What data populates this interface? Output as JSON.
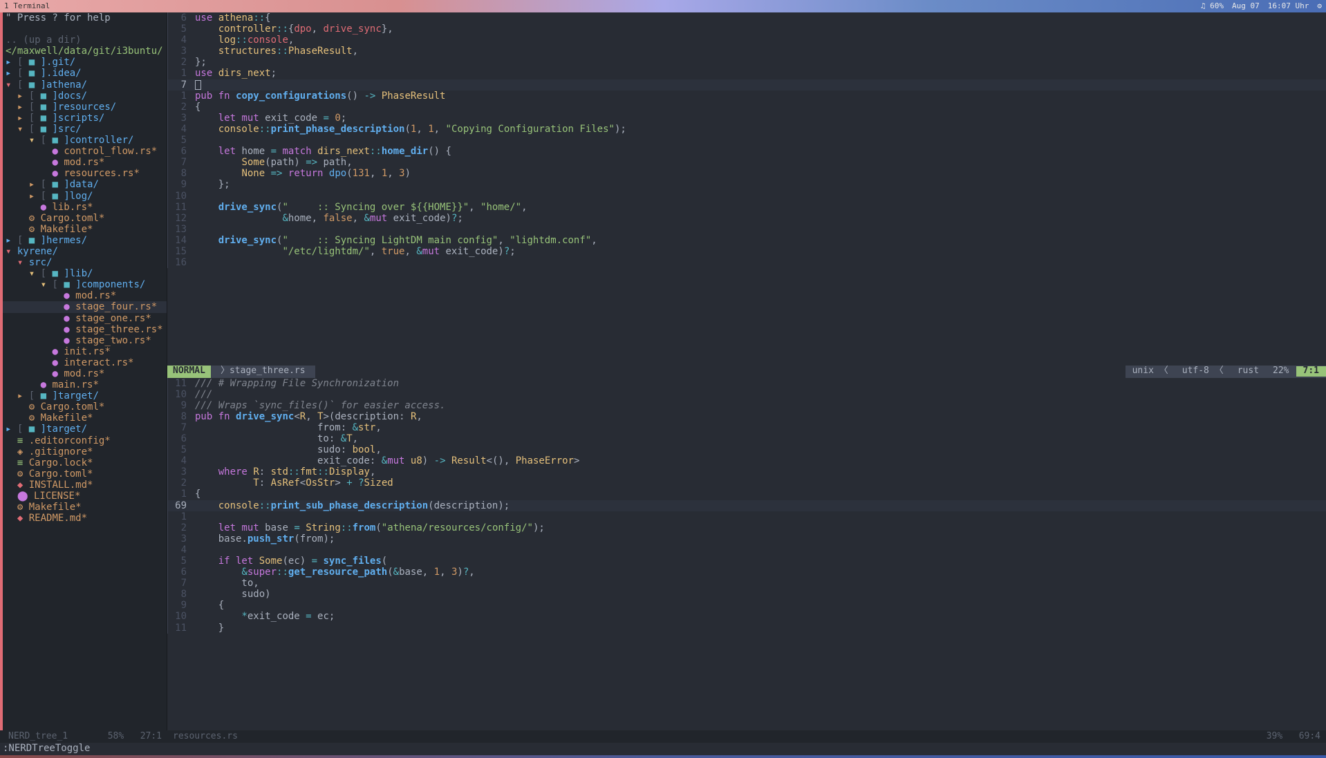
{
  "titlebar": {
    "left": "1 Terminal",
    "battery": "♫ 60%",
    "date": "Aug 07",
    "time": "16:07 Uhr"
  },
  "sidebar": {
    "help": "\" Press ? for help",
    "updir": ".. (up a dir)",
    "path": "</maxwell/data/git/i3buntu/",
    "tree": [
      {
        "indent": 0,
        "arrow": "▸",
        "arrowc": "arrow-b",
        "icon": "■",
        "name": "].git/",
        "dir": true
      },
      {
        "indent": 0,
        "arrow": "▸",
        "arrowc": "arrow-b",
        "icon": "■",
        "name": "].idea/",
        "dir": true
      },
      {
        "indent": 0,
        "arrow": "▾",
        "arrowc": "arrow",
        "icon": "■",
        "name": "]athena/",
        "dir": true
      },
      {
        "indent": 1,
        "arrow": "▸",
        "arrowc": "arrow-o",
        "icon": "■",
        "name": "]docs/",
        "dir": true
      },
      {
        "indent": 1,
        "arrow": "▸",
        "arrowc": "arrow-o",
        "icon": "■",
        "name": "]resources/",
        "dir": true
      },
      {
        "indent": 1,
        "arrow": "▸",
        "arrowc": "arrow-o",
        "icon": "■",
        "name": "]scripts/",
        "dir": true
      },
      {
        "indent": 1,
        "arrow": "▾",
        "arrowc": "arrow-o",
        "icon": "■",
        "name": "]src/",
        "dir": true
      },
      {
        "indent": 2,
        "arrow": "▾",
        "arrowc": "arrow-gold",
        "icon": "■",
        "name": "]controller/",
        "dir": true
      },
      {
        "indent": 3,
        "arrow": "",
        "arrowc": "",
        "icon": "●",
        "iconc": "file-ico",
        "name": "control_flow.rs*",
        "dir": false
      },
      {
        "indent": 3,
        "arrow": "",
        "arrowc": "",
        "icon": "●",
        "iconc": "file-ico",
        "name": "mod.rs*",
        "dir": false
      },
      {
        "indent": 3,
        "arrow": "",
        "arrowc": "",
        "icon": "●",
        "iconc": "file-ico",
        "name": "resources.rs*",
        "dir": false
      },
      {
        "indent": 2,
        "arrow": "▸",
        "arrowc": "arrow-o",
        "icon": "■",
        "name": "]data/",
        "dir": true
      },
      {
        "indent": 2,
        "arrow": "▸",
        "arrowc": "arrow-o",
        "icon": "■",
        "name": "]log/",
        "dir": true
      },
      {
        "indent": 2,
        "arrow": "",
        "arrowc": "",
        "icon": "●",
        "iconc": "file-ico",
        "name": "lib.rs*",
        "dir": false
      },
      {
        "indent": 1,
        "arrow": "",
        "arrowc": "",
        "icon": "⚙",
        "iconc": "file-ico-o",
        "name": "Cargo.toml*",
        "dir": false
      },
      {
        "indent": 1,
        "arrow": "",
        "arrowc": "",
        "icon": "⚙",
        "iconc": "file-ico-o",
        "name": "Makefile*",
        "dir": false
      },
      {
        "indent": 0,
        "arrow": "▸",
        "arrowc": "arrow-b",
        "icon": "■",
        "name": "]hermes/",
        "dir": true
      },
      {
        "indent": 0,
        "arrow": "▾",
        "arrowc": "arrow",
        "icon": "",
        "name": "kyrene/",
        "dir": true,
        "nobracket": true
      },
      {
        "indent": 1,
        "arrow": "▾",
        "arrowc": "arrow",
        "icon": "",
        "name": "src/",
        "dir": true,
        "nobracket": true
      },
      {
        "indent": 2,
        "arrow": "▾",
        "arrowc": "arrow-gold",
        "icon": "■",
        "name": "]lib/",
        "dir": true
      },
      {
        "indent": 3,
        "arrow": "▾",
        "arrowc": "arrow-gold",
        "icon": "■",
        "name": "]components/",
        "dir": true
      },
      {
        "indent": 4,
        "arrow": "",
        "arrowc": "",
        "icon": "●",
        "iconc": "file-ico",
        "name": "mod.rs*",
        "dir": false
      },
      {
        "indent": 4,
        "arrow": "",
        "arrowc": "",
        "icon": "●",
        "iconc": "file-ico",
        "name": "stage_four.rs*",
        "dir": false,
        "hl": true
      },
      {
        "indent": 4,
        "arrow": "",
        "arrowc": "",
        "icon": "●",
        "iconc": "file-ico",
        "name": "stage_one.rs*",
        "dir": false
      },
      {
        "indent": 4,
        "arrow": "",
        "arrowc": "",
        "icon": "●",
        "iconc": "file-ico",
        "name": "stage_three.rs*",
        "dir": false
      },
      {
        "indent": 4,
        "arrow": "",
        "arrowc": "",
        "icon": "●",
        "iconc": "file-ico",
        "name": "stage_two.rs*",
        "dir": false
      },
      {
        "indent": 3,
        "arrow": "",
        "arrowc": "",
        "icon": "●",
        "iconc": "file-ico",
        "name": "init.rs*",
        "dir": false
      },
      {
        "indent": 3,
        "arrow": "",
        "arrowc": "",
        "icon": "●",
        "iconc": "file-ico",
        "name": "interact.rs*",
        "dir": false
      },
      {
        "indent": 3,
        "arrow": "",
        "arrowc": "",
        "icon": "●",
        "iconc": "file-ico",
        "name": "mod.rs*",
        "dir": false
      },
      {
        "indent": 2,
        "arrow": "",
        "arrowc": "",
        "icon": "●",
        "iconc": "file-ico",
        "name": "main.rs*",
        "dir": false
      },
      {
        "indent": 1,
        "arrow": "▸",
        "arrowc": "arrow-o",
        "icon": "■",
        "name": "]target/",
        "dir": true
      },
      {
        "indent": 1,
        "arrow": "",
        "arrowc": "",
        "icon": "⚙",
        "iconc": "file-ico-o",
        "name": "Cargo.toml*",
        "dir": false
      },
      {
        "indent": 1,
        "arrow": "",
        "arrowc": "",
        "icon": "⚙",
        "iconc": "file-ico-o",
        "name": "Makefile*",
        "dir": false
      },
      {
        "indent": 0,
        "arrow": "▸",
        "arrowc": "arrow-b",
        "icon": "■",
        "name": "]target/",
        "dir": true
      },
      {
        "indent": 0,
        "arrow": "",
        "arrowc": "",
        "icon": "≡",
        "iconc": "file-ico-g",
        "name": ".editorconfig*",
        "dir": false
      },
      {
        "indent": 0,
        "arrow": "",
        "arrowc": "",
        "icon": "◈",
        "iconc": "file-ico-o",
        "name": ".gitignore*",
        "dir": false
      },
      {
        "indent": 0,
        "arrow": "",
        "arrowc": "",
        "icon": "≡",
        "iconc": "file-ico-g",
        "name": "Cargo.lock*",
        "dir": false
      },
      {
        "indent": 0,
        "arrow": "",
        "arrowc": "",
        "icon": "⚙",
        "iconc": "file-ico-o",
        "name": "Cargo.toml*",
        "dir": false
      },
      {
        "indent": 0,
        "arrow": "",
        "arrowc": "",
        "icon": "◆",
        "iconc": "file-ico-r",
        "name": "INSTALL.md*",
        "dir": false
      },
      {
        "indent": 0,
        "arrow": "",
        "arrowc": "",
        "icon": "⬤",
        "iconc": "file-ico-p",
        "name": "LICENSE*",
        "dir": false
      },
      {
        "indent": 0,
        "arrow": "",
        "arrowc": "",
        "icon": "⚙",
        "iconc": "file-ico-o",
        "name": "Makefile*",
        "dir": false
      },
      {
        "indent": 0,
        "arrow": "",
        "arrowc": "",
        "icon": "◆",
        "iconc": "file-ico-r",
        "name": "README.md*",
        "dir": false
      }
    ]
  },
  "pane1": {
    "lines": [
      {
        "n": "6",
        "html": "<span class='kw'>use</span> <span class='ty'>athena</span><span class='op'>::</span><span class='punct'>{</span>"
      },
      {
        "n": "5",
        "html": "    <span class='ty'>controller</span><span class='op'>::</span><span class='punct'>{</span><span class='ident'>dpo</span><span class='punct'>,</span> <span class='ident'>drive_sync</span><span class='punct'>},</span>"
      },
      {
        "n": "4",
        "html": "    <span class='ty'>log</span><span class='op'>::</span><span class='ident'>console</span><span class='punct'>,</span>"
      },
      {
        "n": "3",
        "html": "    <span class='ty'>structures</span><span class='op'>::</span><span class='ty'>PhaseResult</span><span class='punct'>,</span>"
      },
      {
        "n": "2",
        "html": "<span class='punct'>};</span>"
      },
      {
        "n": "1",
        "html": "<span class='kw'>use</span> <span class='ty'>dirs_next</span><span class='punct'>;</span>"
      },
      {
        "n": "7",
        "html": "<span class='cursor-box'></span>",
        "hl": true
      },
      {
        "n": "1",
        "html": "<span class='kw'>pub fn</span> <span class='fn'>copy_configurations</span><span class='punct'>()</span> <span class='op'>-&gt;</span> <span class='ty'>PhaseResult</span>"
      },
      {
        "n": "2",
        "html": "<span class='punct'>{</span>"
      },
      {
        "n": "3",
        "html": "    <span class='kw'>let</span> <span class='kw'>mut</span> exit_code <span class='op'>=</span> <span class='num'>0</span><span class='punct'>;</span>"
      },
      {
        "n": "4",
        "html": "    <span class='ty'>console</span><span class='op'>::</span><span class='fn'>print_phase_description</span><span class='punct'>(</span><span class='num'>1</span><span class='punct'>,</span> <span class='num'>1</span><span class='punct'>,</span> <span class='str'>\"Copying Configuration Files\"</span><span class='punct'>);</span>"
      },
      {
        "n": "5",
        "html": ""
      },
      {
        "n": "6",
        "html": "    <span class='kw'>let</span> home <span class='op'>=</span> <span class='kw'>match</span> <span class='ty'>dirs_next</span><span class='op'>::</span><span class='fn'>home_dir</span><span class='punct'>()</span> <span class='punct'>{</span>"
      },
      {
        "n": "7",
        "html": "        <span class='ty'>Some</span><span class='punct'>(</span>path<span class='punct'>)</span> <span class='op'>=&gt;</span> path<span class='punct'>,</span>"
      },
      {
        "n": "8",
        "html": "        <span class='ty'>None</span> <span class='op'>=&gt;</span> <span class='kw'>return</span> <span class='fnc'>dpo</span><span class='punct'>(</span><span class='num'>131</span><span class='punct'>,</span> <span class='num'>1</span><span class='punct'>,</span> <span class='num'>3</span><span class='punct'>)</span>"
      },
      {
        "n": "9",
        "html": "    <span class='punct'>};</span>"
      },
      {
        "n": "10",
        "html": ""
      },
      {
        "n": "11",
        "html": "    <span class='fn'>drive_sync</span><span class='punct'>(</span><span class='str'>\"     :: Syncing over ${{HOME}}\"</span><span class='punct'>,</span> <span class='str'>\"home/\"</span><span class='punct'>,</span>"
      },
      {
        "n": "12",
        "html": "               <span class='op'>&amp;</span>home<span class='punct'>,</span> <span class='num'>false</span><span class='punct'>,</span> <span class='op'>&amp;</span><span class='kw'>mut</span> exit_code<span class='punct'>)</span><span class='op'>?</span><span class='punct'>;</span>"
      },
      {
        "n": "13",
        "html": ""
      },
      {
        "n": "14",
        "html": "    <span class='fn'>drive_sync</span><span class='punct'>(</span><span class='str'>\"     :: Syncing LightDM main config\"</span><span class='punct'>,</span> <span class='str'>\"lightdm.conf\"</span><span class='punct'>,</span>"
      },
      {
        "n": "15",
        "html": "               <span class='str'>\"/etc/lightdm/\"</span><span class='punct'>,</span> <span class='num'>true</span><span class='punct'>,</span> <span class='op'>&amp;</span><span class='kw'>mut</span> exit_code<span class='punct'>)</span><span class='op'>?</span><span class='punct'>;</span>"
      },
      {
        "n": "16",
        "html": ""
      }
    ]
  },
  "status1": {
    "mode": "NORMAL",
    "file": "stage_three.rs",
    "unix": "unix",
    "enc": "utf-8",
    "lang": "rust",
    "pct": "22%",
    "pos": "7:1"
  },
  "pane2": {
    "lines": [
      {
        "n": "11",
        "html": "<span class='docc'>/// # Wrapping File Synchronization</span>"
      },
      {
        "n": "10",
        "html": "<span class='docc'>///</span>"
      },
      {
        "n": "9",
        "html": "<span class='docc'>/// Wraps `sync_files()` for easier access.</span>"
      },
      {
        "n": "8",
        "html": "<span class='kw'>pub fn</span> <span class='fn'>drive_sync</span><span class='punct'>&lt;</span><span class='ty'>R</span><span class='punct'>,</span> <span class='ty'>T</span><span class='punct'>&gt;(</span>description<span class='punct'>:</span> <span class='ty'>R</span><span class='punct'>,</span>"
      },
      {
        "n": "7",
        "html": "                     from<span class='punct'>:</span> <span class='op'>&amp;</span><span class='ty'>str</span><span class='punct'>,</span>"
      },
      {
        "n": "6",
        "html": "                     to<span class='punct'>:</span> <span class='op'>&amp;</span><span class='ty'>T</span><span class='punct'>,</span>"
      },
      {
        "n": "5",
        "html": "                     sudo<span class='punct'>:</span> <span class='ty'>bool</span><span class='punct'>,</span>"
      },
      {
        "n": "4",
        "html": "                     exit_code<span class='punct'>:</span> <span class='op'>&amp;</span><span class='kw'>mut</span> <span class='ty'>u8</span><span class='punct'>)</span> <span class='op'>-&gt;</span> <span class='ty'>Result</span><span class='punct'>&lt;()</span><span class='punct'>,</span> <span class='ty'>PhaseError</span><span class='punct'>&gt;</span>"
      },
      {
        "n": "3",
        "html": "    <span class='kw'>where</span> <span class='ty'>R</span><span class='punct'>:</span> <span class='ty'>std</span><span class='op'>::</span><span class='ty'>fmt</span><span class='op'>::</span><span class='ty'>Display</span><span class='punct'>,</span>"
      },
      {
        "n": "2",
        "html": "          <span class='ty'>T</span><span class='punct'>:</span> <span class='ty'>AsRef</span><span class='punct'>&lt;</span><span class='ty'>OsStr</span><span class='punct'>&gt;</span> <span class='op'>+</span> <span class='op'>?</span><span class='ty'>Sized</span>"
      },
      {
        "n": "1",
        "html": "<span class='punct'>{</span>"
      },
      {
        "n": "69",
        "html": "    <span class='ty'>console</span><span class='op'>::</span><span class='fn'>print_sub_phase_description</span><span class='punct'>(</span>description<span class='punct'>);</span>",
        "hl": true
      },
      {
        "n": "1",
        "html": ""
      },
      {
        "n": "2",
        "html": "    <span class='kw'>let</span> <span class='kw'>mut</span> base <span class='op'>=</span> <span class='ty'>String</span><span class='op'>::</span><span class='fn'>from</span><span class='punct'>(</span><span class='str'>\"athena/resources/config/\"</span><span class='punct'>);</span>"
      },
      {
        "n": "3",
        "html": "    base<span class='punct'>.</span><span class='fn'>push_str</span><span class='punct'>(</span>from<span class='punct'>);</span>"
      },
      {
        "n": "4",
        "html": ""
      },
      {
        "n": "5",
        "html": "    <span class='kw'>if let</span> <span class='ty'>Some</span><span class='punct'>(</span>ec<span class='punct'>)</span> <span class='op'>=</span> <span class='fn'>sync_files</span><span class='punct'>(</span>"
      },
      {
        "n": "6",
        "html": "        <span class='op'>&amp;</span><span class='kw'>super</span><span class='op'>::</span><span class='fn'>get_resource_path</span><span class='punct'>(</span><span class='op'>&amp;</span>base<span class='punct'>,</span> <span class='num'>1</span><span class='punct'>,</span> <span class='num'>3</span><span class='punct'>)</span><span class='op'>?</span><span class='punct'>,</span>"
      },
      {
        "n": "7",
        "html": "        to<span class='punct'>,</span>"
      },
      {
        "n": "8",
        "html": "        sudo<span class='punct'>)</span>"
      },
      {
        "n": "9",
        "html": "    <span class='punct'>{</span>"
      },
      {
        "n": "10",
        "html": "        <span class='op'>*</span>exit_code <span class='op'>=</span> ec<span class='punct'>;</span>"
      },
      {
        "n": "11",
        "html": "    <span class='punct'>}</span>"
      }
    ]
  },
  "bottombar": {
    "left_name": "NERD_tree_1",
    "left_pct": "58%",
    "left_pos": "27:1",
    "right_name": "resources.rs",
    "right_pct": "39%",
    "right_pos": "69:4"
  },
  "cmdline": ":NERDTreeToggle"
}
